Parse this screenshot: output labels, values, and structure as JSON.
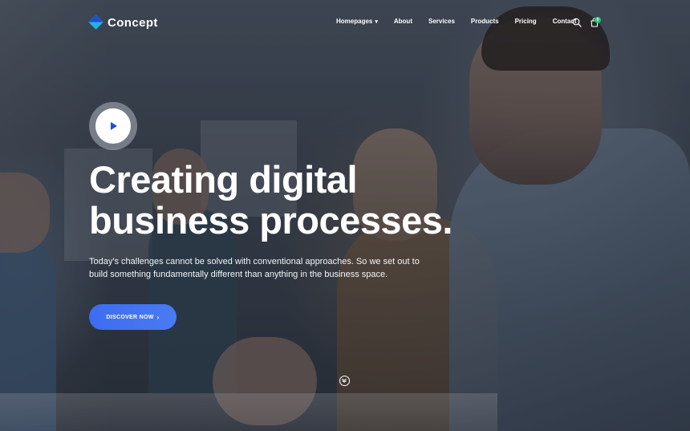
{
  "brand": {
    "name": "Concept"
  },
  "nav": {
    "items": [
      {
        "label": "Homepages",
        "has_dropdown": true
      },
      {
        "label": "About"
      },
      {
        "label": "Services"
      },
      {
        "label": "Products"
      },
      {
        "label": "Pricing"
      },
      {
        "label": "Contact"
      }
    ],
    "icons": {
      "search": "search-icon",
      "cart": "cart-icon"
    },
    "cart_count": "0"
  },
  "hero": {
    "play_icon": "play-icon",
    "headline_line1": "Creating digital",
    "headline_line2": "business processes.",
    "subtitle_line1": "Today's challenges cannot be solved with conventional approaches. So we set out to",
    "subtitle_line2": "build something fundamentally different than anything in the business space.",
    "cta_label": "DISCOVER NOW",
    "cta_icon": "chevron-right-icon",
    "scroll_icon": "scroll-down-icon"
  },
  "colors": {
    "accent": "#3b6df0",
    "brand_light": "#22b3e6",
    "brand_dark": "#1d4fd6",
    "badge": "#27c27a"
  }
}
